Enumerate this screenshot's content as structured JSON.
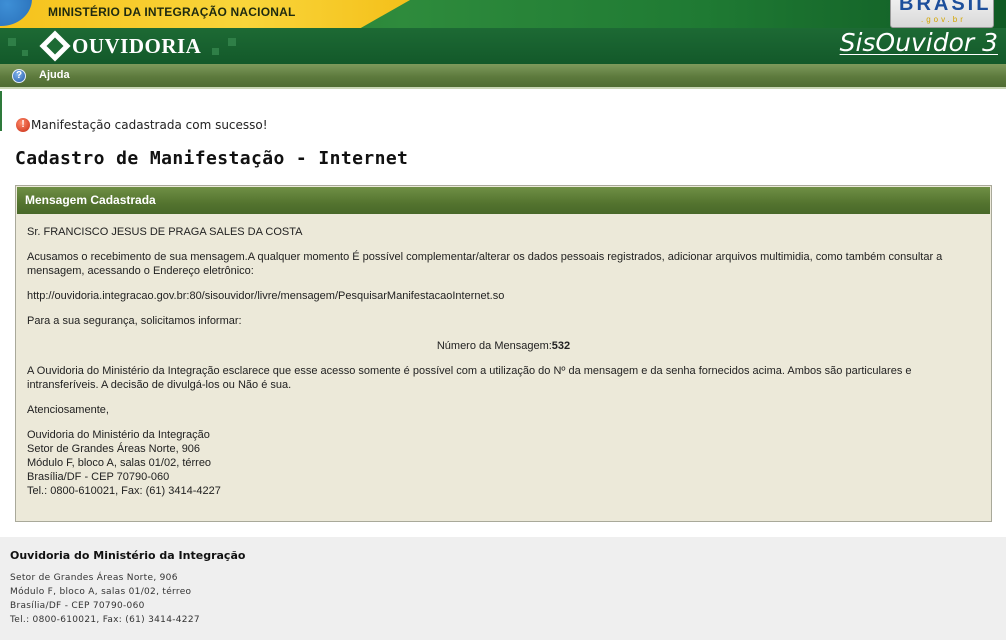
{
  "gov_bar": {
    "ministry": "MINISTÉRIO DA INTEGRAÇÃO NACIONAL",
    "brasil_logo": "BRASIL",
    "brasil_sub": ".gov.br"
  },
  "header": {
    "title": "OUVIDORIA",
    "app_name": "SisOuvidor 3"
  },
  "menu": {
    "help_label": "Ajuda"
  },
  "status": {
    "success_message": "Manifestação cadastrada com sucesso!"
  },
  "page": {
    "title": "Cadastro de Manifestação - Internet"
  },
  "panel": {
    "header": "Mensagem Cadastrada",
    "greeting": "Sr. FRANCISCO JESUS DE PRAGA SALES DA COSTA",
    "ack_text": "Acusamos o recebimento de sua mensagem.A qualquer momento É possível complementar/alterar os dados pessoais registrados, adicionar arquivos multimidia, como também consultar a mensagem, acessando o Endereço eletrônico:",
    "url": "http://ouvidoria.integracao.gov.br:80/sisouvidor/livre/mensagem/PesquisarManifestacaoInternet.so",
    "security_text": "Para a sua segurança, solicitamos informar:",
    "message_number_label": "Número da Mensagem:",
    "message_number": "532",
    "notice_text": "A Ouvidoria do Ministério da Integração esclarece que esse acesso somente é possível com a utilização do Nº da mensagem e da senha fornecidos acima. Ambos são particulares e intransferíveis. A decisão de divulgá-los ou Não é sua.",
    "closing": "Atenciosamente,",
    "address_lines": [
      "Ouvidoria do Ministério da Integração",
      "Setor de Grandes Áreas Norte, 906",
      "Módulo F, bloco A, salas 01/02, térreo",
      "Brasília/DF - CEP 70790-060",
      "Tel.: 0800-610021, Fax: (61) 3414-4227"
    ]
  },
  "footer": {
    "title": "Ouvidoria do Ministério da Integração",
    "address_lines": [
      "Setor de Grandes Áreas Norte, 906",
      "Módulo F, bloco A, salas 01/02, térreo",
      "Brasília/DF - CEP 70790-060",
      "Tel.: 0800-610021, Fax: (61) 3414-4227"
    ]
  },
  "colors": {
    "header_green": "#1d6a34",
    "menu_green": "#5d7a3d",
    "panel_bg": "#ece9d9",
    "gov_yellow": "#f6c21c"
  }
}
